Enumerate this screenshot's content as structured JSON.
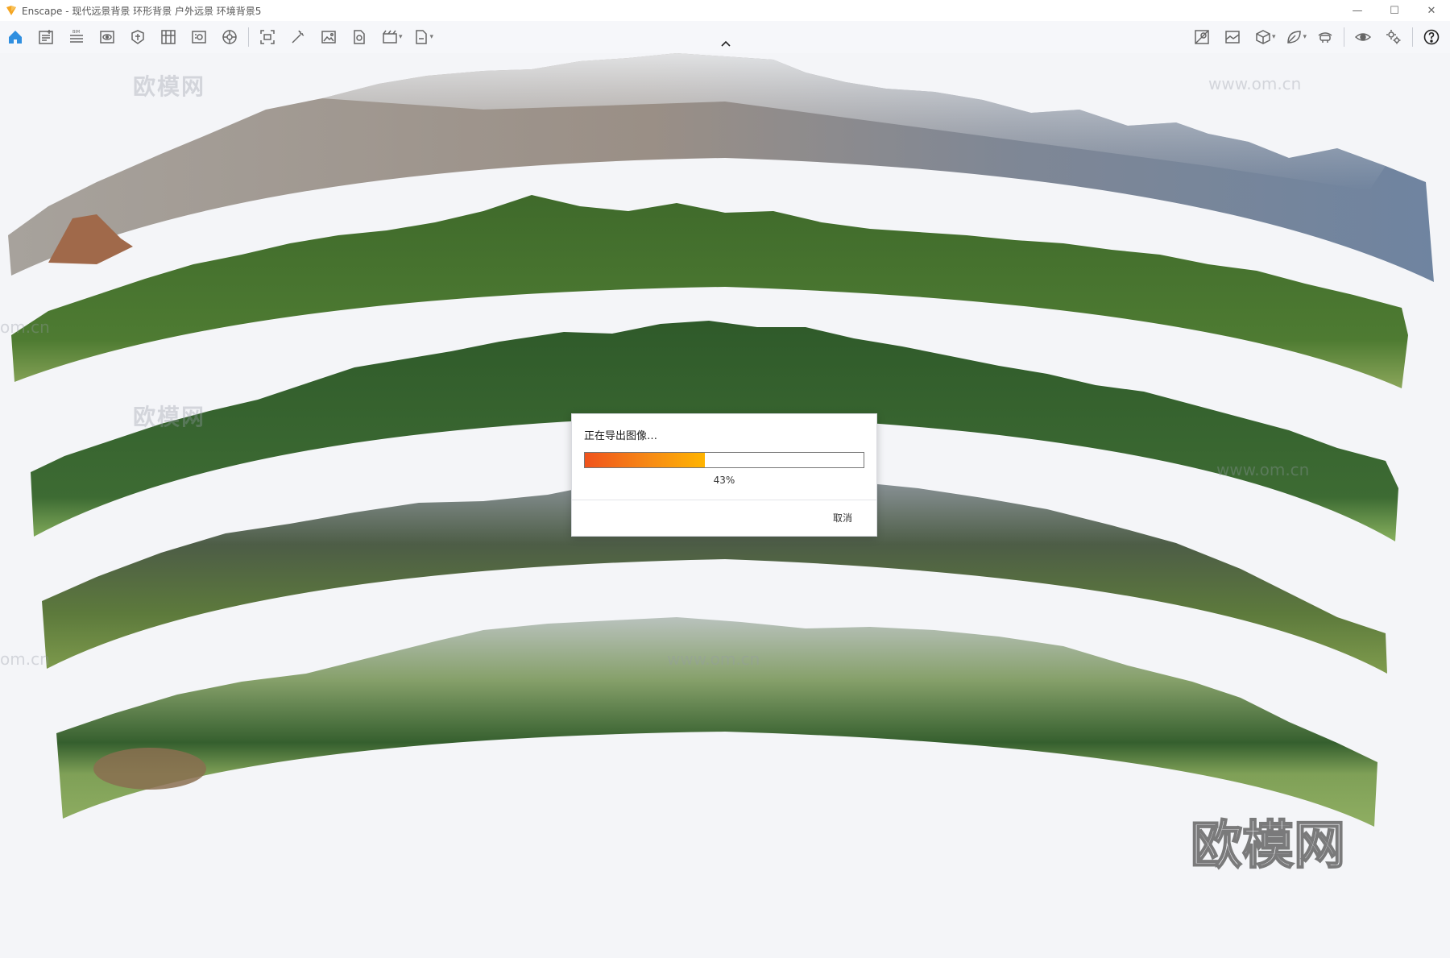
{
  "window": {
    "app_name": "Enscape",
    "title": "Enscape - 现代远景背景 环形背景 户外远景 环境背景5",
    "accent": "#f5a623"
  },
  "toolbar": {
    "left_icons": [
      "home-icon",
      "new-view-icon",
      "bim-icon",
      "views-icon",
      "asset-library-icon",
      "material-editor-icon",
      "properties-icon",
      "atmosphere-icon"
    ],
    "render_icons": [
      "screenshot-icon",
      "batch-render-icon",
      "image-export-icon",
      "panorama-icon",
      "video-editor-icon",
      "export-exe-icon"
    ],
    "right_icons": [
      "site-context-icon",
      "background-image-icon",
      "cube-icon",
      "leaf-icon",
      "vr-icon",
      "visibility-icon",
      "settings-icon",
      "help-icon"
    ],
    "bim_label": "BIM"
  },
  "dialog": {
    "title": "正在导出图像…",
    "progress": 43,
    "progress_label": "43%",
    "cancel_label": "取消"
  },
  "watermarks": {
    "site_logo": "欧模网",
    "site_url": "www.om.cn",
    "url_fragment": "om.cn"
  },
  "colors": {
    "progress_start": "#f0531c",
    "progress_end": "#ffb400",
    "background": "#f4f5f8"
  }
}
